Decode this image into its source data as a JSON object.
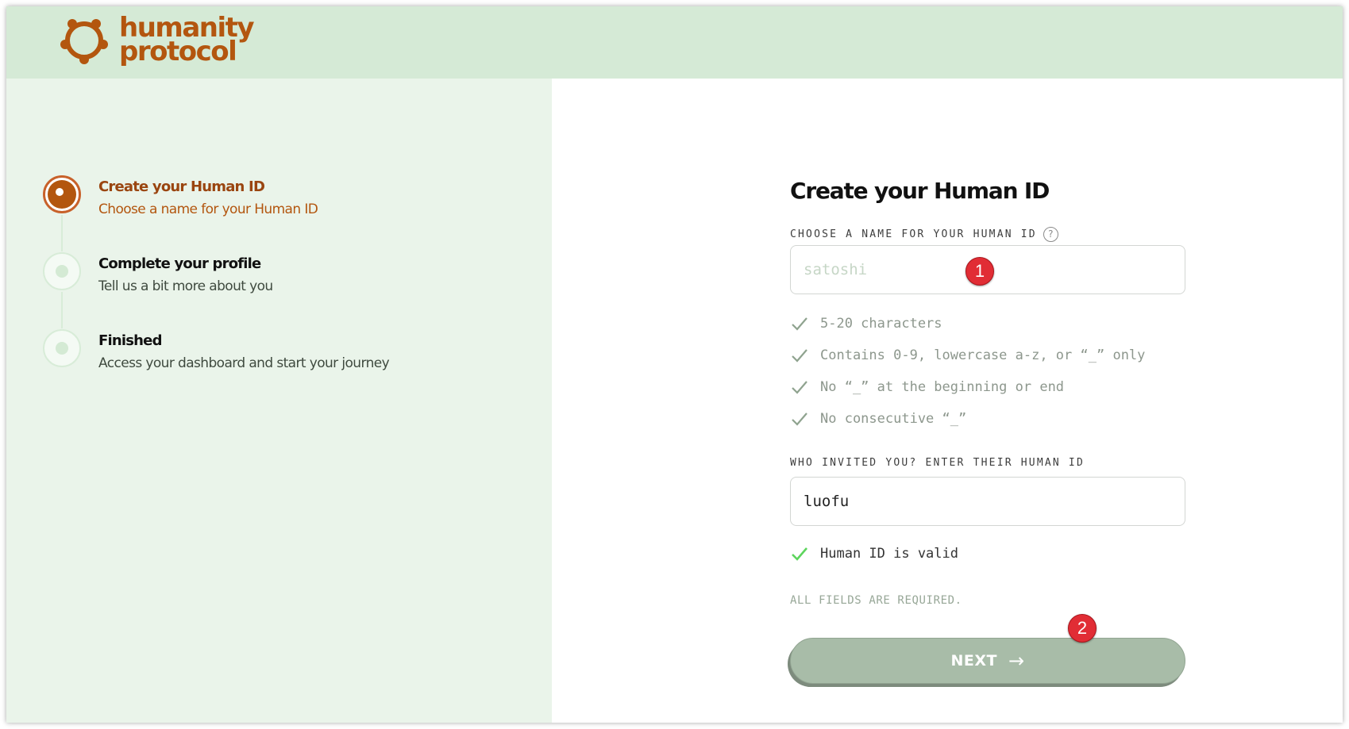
{
  "brand": {
    "line1": "humanity",
    "line2": "protocol",
    "color": "#b3560f",
    "icon": "humanity-logo-icon"
  },
  "steps": [
    {
      "title": "Create your Human ID",
      "subtitle": "Choose a name for your Human ID",
      "state": "active"
    },
    {
      "title": "Complete your profile",
      "subtitle": "Tell us a bit more about you",
      "state": "pending"
    },
    {
      "title": "Finished",
      "subtitle": "Access your dashboard and start your journey",
      "state": "pending"
    }
  ],
  "form": {
    "title": "Create your Human ID",
    "name_field": {
      "label": "CHOOSE A NAME FOR YOUR HUMAN ID",
      "placeholder": "satoshi",
      "value": "",
      "help_icon": "?"
    },
    "rules": [
      "5-20 characters",
      "Contains 0-9, lowercase a-z, or “_” only",
      "No “_” at the beginning or end",
      "No consecutive “_”"
    ],
    "invite_field": {
      "label": "WHO INVITED YOU? ENTER THEIR HUMAN ID",
      "value": "luofu"
    },
    "valid_message": "Human ID is valid",
    "required_note": "ALL FIELDS ARE REQUIRED.",
    "next_label": "NEXT",
    "next_arrow": "→"
  },
  "annotations": [
    "1",
    "2"
  ],
  "colors": {
    "header_bg": "#d5ead6",
    "left_panel_bg": "#eaf4ea",
    "accent": "#b3560f",
    "button_bg": "#a8bca8",
    "valid_check": "#5dd55d",
    "rule_check": "#8fa38f",
    "badge": "#e12d35"
  }
}
